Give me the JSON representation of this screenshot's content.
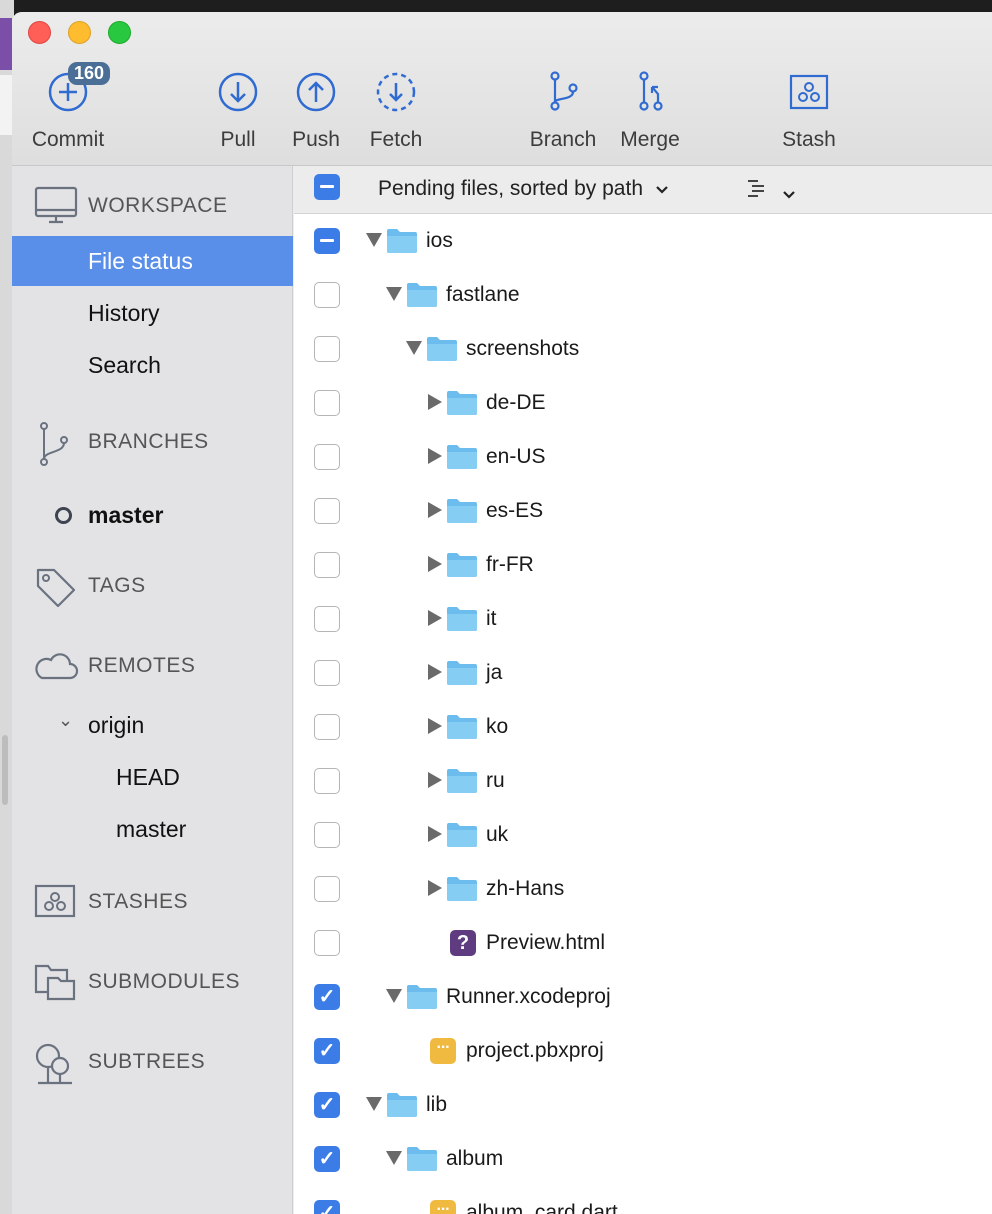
{
  "toolbar": {
    "commit_badge": "160",
    "buttons": [
      {
        "label": "Commit",
        "icon": "commit-icon"
      },
      {
        "label": "Pull",
        "icon": "pull-icon"
      },
      {
        "label": "Push",
        "icon": "push-icon"
      },
      {
        "label": "Fetch",
        "icon": "fetch-icon"
      },
      {
        "label": "Branch",
        "icon": "branch-icon"
      },
      {
        "label": "Merge",
        "icon": "merge-icon"
      },
      {
        "label": "Stash",
        "icon": "stash-icon"
      }
    ]
  },
  "sidebar": {
    "workspace": {
      "title": "WORKSPACE",
      "items": [
        "File status",
        "History",
        "Search"
      ],
      "selected": "File status"
    },
    "branches": {
      "title": "BRANCHES",
      "items": [
        "master"
      ],
      "current": "master"
    },
    "tags": {
      "title": "TAGS"
    },
    "remotes": {
      "title": "REMOTES",
      "origin": "origin",
      "items": [
        "HEAD",
        "master"
      ]
    },
    "stashes": {
      "title": "STASHES"
    },
    "submodules": {
      "title": "SUBMODULES"
    },
    "subtrees": {
      "title": "SUBTREES"
    }
  },
  "main": {
    "header": {
      "sort_label": "Pending files, sorted by path"
    },
    "rows": [
      {
        "name": "ios",
        "kind": "folder",
        "state": "partial",
        "expanded": true
      },
      {
        "name": "fastlane",
        "kind": "folder",
        "state": "off",
        "expanded": true
      },
      {
        "name": "screenshots",
        "kind": "folder",
        "state": "off",
        "expanded": true
      },
      {
        "name": "de-DE",
        "kind": "folder",
        "state": "off",
        "expanded": false
      },
      {
        "name": "en-US",
        "kind": "folder",
        "state": "off",
        "expanded": false
      },
      {
        "name": "es-ES",
        "kind": "folder",
        "state": "off",
        "expanded": false
      },
      {
        "name": "fr-FR",
        "kind": "folder",
        "state": "off",
        "expanded": false
      },
      {
        "name": "it",
        "kind": "folder",
        "state": "off",
        "expanded": false
      },
      {
        "name": "ja",
        "kind": "folder",
        "state": "off",
        "expanded": false
      },
      {
        "name": "ko",
        "kind": "folder",
        "state": "off",
        "expanded": false
      },
      {
        "name": "ru",
        "kind": "folder",
        "state": "off",
        "expanded": false
      },
      {
        "name": "uk",
        "kind": "folder",
        "state": "off",
        "expanded": false
      },
      {
        "name": "zh-Hans",
        "kind": "folder",
        "state": "off",
        "expanded": false
      },
      {
        "name": "Preview.html",
        "kind": "untracked-file",
        "state": "off"
      },
      {
        "name": "Runner.xcodeproj",
        "kind": "folder",
        "state": "on",
        "expanded": true
      },
      {
        "name": "project.pbxproj",
        "kind": "modified-file",
        "state": "on"
      },
      {
        "name": "lib",
        "kind": "folder",
        "state": "on",
        "expanded": true
      },
      {
        "name": "album",
        "kind": "folder",
        "state": "on",
        "expanded": true
      },
      {
        "name": "album_card.dart",
        "kind": "modified-file",
        "state": "on"
      }
    ]
  },
  "colors": {
    "selection": "#5a8fe9",
    "checkbox": "#3b7ce6",
    "icon_blue": "#2f6bd1",
    "folder": "#6cbcee"
  }
}
